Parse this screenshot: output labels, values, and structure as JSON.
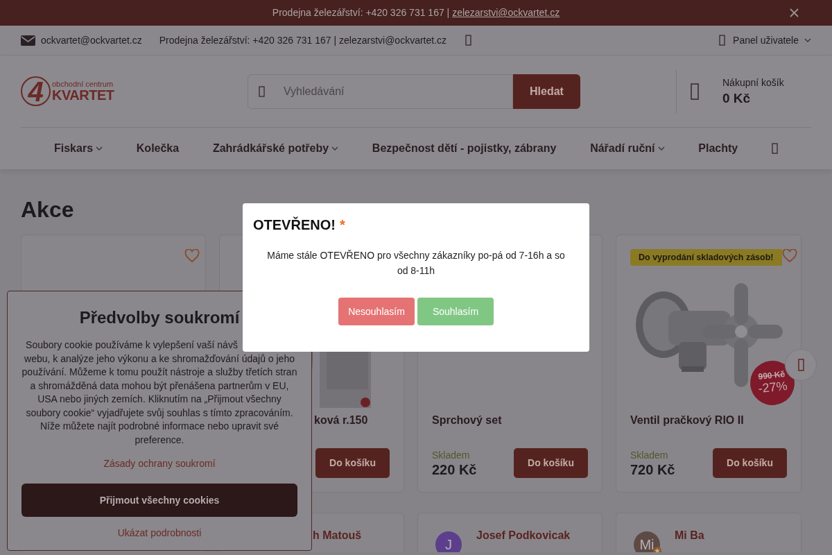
{
  "promo_bar": {
    "text": "Prodejna železářství: +420 326 731 167 |",
    "email": "zelezarstvi@ockvartet.cz"
  },
  "top_bar": {
    "email": "ockvartet@ockvartet.cz",
    "info": "Prodejna železářství: +420 326 731 167 | zelezarstvi@ockvartet.cz",
    "user_panel": "Panel uživatele"
  },
  "header": {
    "logo": {
      "mark": "4",
      "line1": "obchodní centrum",
      "line2": "KVARTET"
    },
    "search": {
      "placeholder": "Vyhledávání",
      "button": "Hledat"
    },
    "cart": {
      "label": "Nákupní košík",
      "total": "0 Kč"
    }
  },
  "nav": [
    {
      "label": "Fiskars",
      "dropdown": true
    },
    {
      "label": "Kolečka",
      "dropdown": false
    },
    {
      "label": "Zahrádkářské potřeby",
      "dropdown": true
    },
    {
      "label": "Bezpečnost dětí - pojistky, zábrany",
      "dropdown": false
    },
    {
      "label": "Nářadí ruční",
      "dropdown": true
    },
    {
      "label": "Plachty",
      "dropdown": false
    }
  ],
  "page_title": "Akce",
  "products": [
    {
      "kind": "hidden",
      "heart": true
    },
    {
      "kind": "clipped",
      "heart": false,
      "title": "ková r.150",
      "button": "Do košíku"
    },
    {
      "kind": "full",
      "heart": false,
      "title": "Sprchový set",
      "stock": "Skladem",
      "price": "220 Kč",
      "button": "Do košíku"
    },
    {
      "kind": "full",
      "heart": true,
      "badge": "Do vyprodání skladových zásob!",
      "old_price": "990 Kč",
      "discount": "-27%",
      "title": "Ventil pračkový RIO II",
      "stock": "Skladem",
      "price": "720 Kč",
      "button": "Do košíku"
    }
  ],
  "reviews": [
    {
      "kind": "hidden"
    },
    {
      "kind": "clipped",
      "name": "h Matouš"
    },
    {
      "kind": "full",
      "initials": "J",
      "color": "#5b3f8c",
      "name": "Josef Podkovicak",
      "star": false
    },
    {
      "kind": "full",
      "initials": "Mi",
      "color": "#5e4a45",
      "name": "Mi Ba",
      "star": true
    }
  ],
  "modal": {
    "title": "OTEVŘENO!",
    "mark": "*",
    "text": "Máme stále OTEVŘENO pro všechny zákazníky po-pá od 7-16h a so od 8-11h",
    "buttons": [
      {
        "label": "Nesouhlasím",
        "kind": "decline"
      },
      {
        "label": "Souhlasím",
        "kind": "accept"
      }
    ]
  },
  "cookie_panel": {
    "title": "Předvolby soukromí",
    "text": "Soubory cookie používáme k vylepšení vaší návš\nwebu, k analýze jeho výkonu a ke shromažďování údajů o jeho používání. Můžeme k tomu použít nástroje a služby třetích stran a shromážděná data mohou být přenášena partnerům v EU, USA nebo jiných zemích. Kliknutím na „Přijmout všechny soubory cookie“ vyjadřujete svůj souhlas s tímto zpracováním. Níže můžete najít podrobné informace nebo upravit své preference.",
    "policy_link": "Zásady ochrany soukromí",
    "accept_button": "Přijmout všechny cookies",
    "details_link": "Ukázat podrobnosti"
  }
}
